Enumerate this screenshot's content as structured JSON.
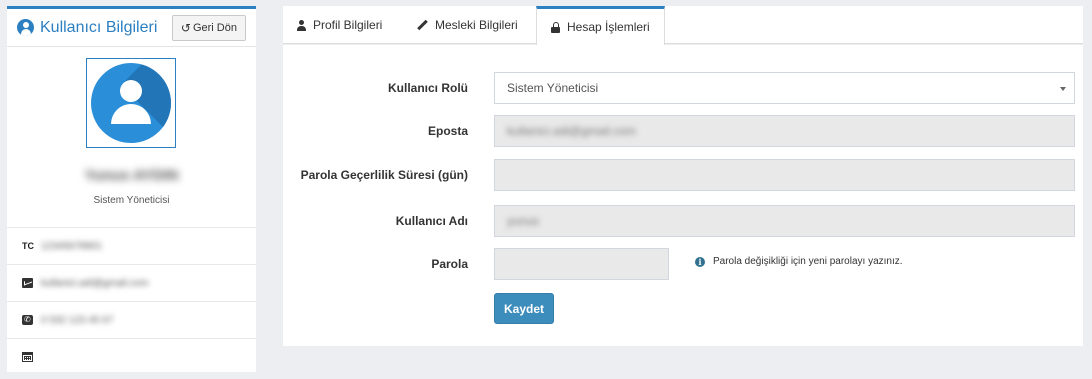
{
  "profile_card": {
    "title": "Kullanıcı Bilgileri",
    "back_button_label": "Geri Dön",
    "name": "Yunus AYDIN",
    "role": "Sistem Yöneticisi",
    "tc_label": "TC",
    "tc_value": "12345678901",
    "email": "kullanici.adi@gmail.com",
    "phone": "0 532 123 45 67"
  },
  "tabs": [
    {
      "label": "Profil Bilgileri",
      "icon": "user-icon",
      "active": false
    },
    {
      "label": "Mesleki Bilgileri",
      "icon": "pencil-icon",
      "active": false
    },
    {
      "label": "Hesap İşlemleri",
      "icon": "lock-icon",
      "active": true
    }
  ],
  "form": {
    "role_label": "Kullanıcı Rolü",
    "role_value": "Sistem Yöneticisi",
    "email_label": "Eposta",
    "email_value": "kullanici.adi@gmail.com",
    "password_validity_label": "Parola Geçerlilik Süresi (gün)",
    "password_validity_value": "",
    "username_label": "Kullanıcı Adı",
    "username_value": "yunus",
    "password_label": "Parola",
    "password_value": "",
    "password_hint": "Parola değişikliği için yeni parolayı yazınız.",
    "save_label": "Kaydet"
  },
  "colors": {
    "accent": "#2c7fc1",
    "save_button": "#3c8dbc",
    "background": "#eceef1"
  }
}
